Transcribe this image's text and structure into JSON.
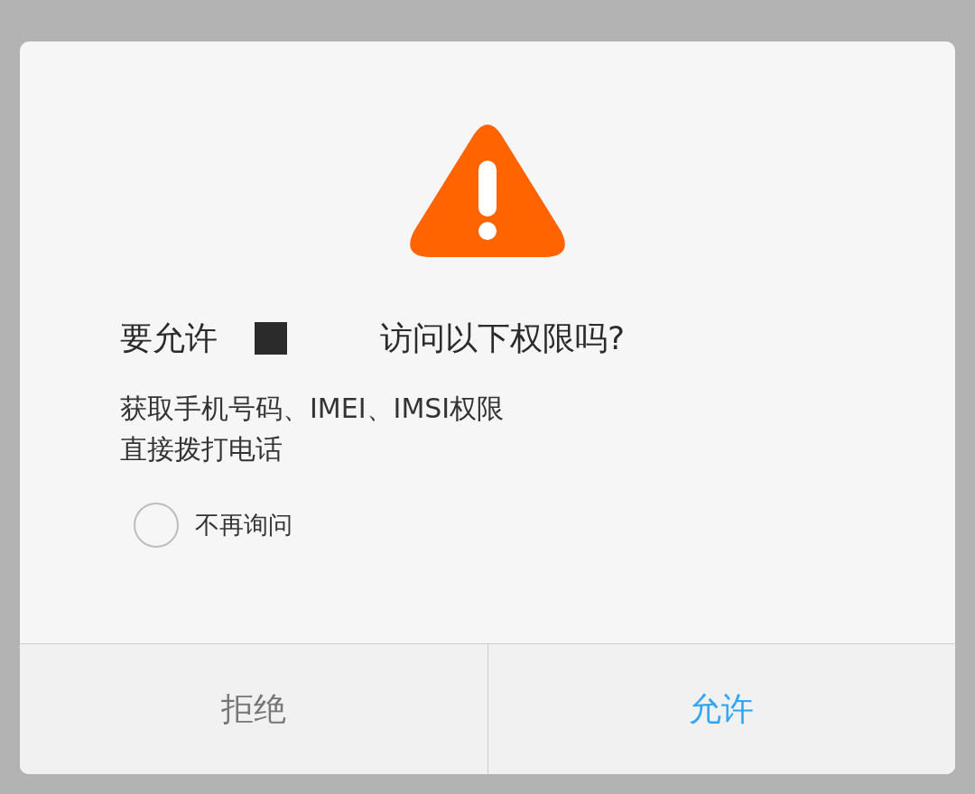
{
  "dialog": {
    "title_parts": [
      "要允许",
      "访问以下权限吗?"
    ],
    "permissions": [
      "获取手机号码、IMEI、IMSI权限",
      "直接拨打电话"
    ],
    "dont_ask_again": {
      "label": "不再询问",
      "checked": false
    },
    "buttons": [
      {
        "label": "拒绝",
        "kind": "secondary"
      },
      {
        "label": "允许",
        "kind": "primary"
      }
    ]
  }
}
